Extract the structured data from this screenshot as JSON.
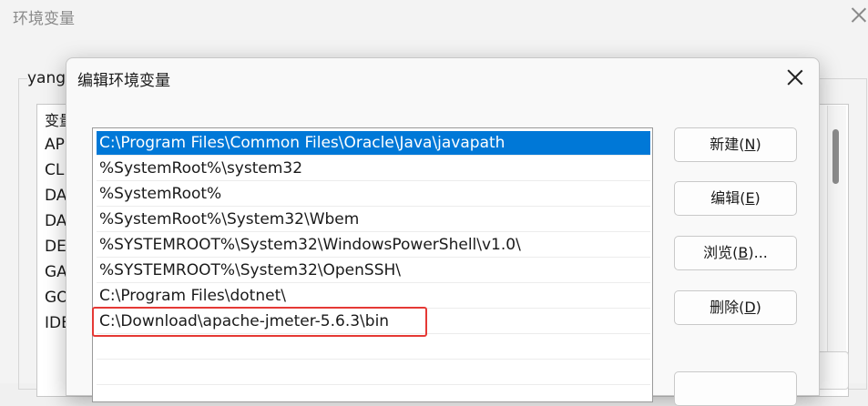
{
  "background_window": {
    "title": "环境变量",
    "group_label": "yang",
    "list_header": "变量",
    "rows": [
      "AP",
      "CLI",
      "DA",
      "DA",
      "DE",
      "GA",
      "GO",
      "IDE"
    ]
  },
  "dialog": {
    "title": "编辑环境变量",
    "paths": [
      "C:\\Program Files\\Common Files\\Oracle\\Java\\javapath",
      "%SystemRoot%\\system32",
      "%SystemRoot%",
      "%SystemRoot%\\System32\\Wbem",
      "%SYSTEMROOT%\\System32\\WindowsPowerShell\\v1.0\\",
      "%SYSTEMROOT%\\System32\\OpenSSH\\",
      "C:\\Program Files\\dotnet\\",
      "C:\\Download\\apache-jmeter-5.6.3\\bin",
      "",
      ""
    ],
    "selected_index": 0,
    "highlighted_index": 7,
    "buttons": {
      "new": {
        "label": "新建(",
        "key": "N",
        "end": ")"
      },
      "edit": {
        "label": "编辑(",
        "key": "E",
        "end": ")"
      },
      "browse": {
        "label": "浏览(",
        "key": "B",
        "end": ")..."
      },
      "delete": {
        "label": "删除(",
        "key": "D",
        "end": ")"
      }
    }
  },
  "colors": {
    "selection": "#0078d7",
    "highlight_box": "#e53935"
  }
}
